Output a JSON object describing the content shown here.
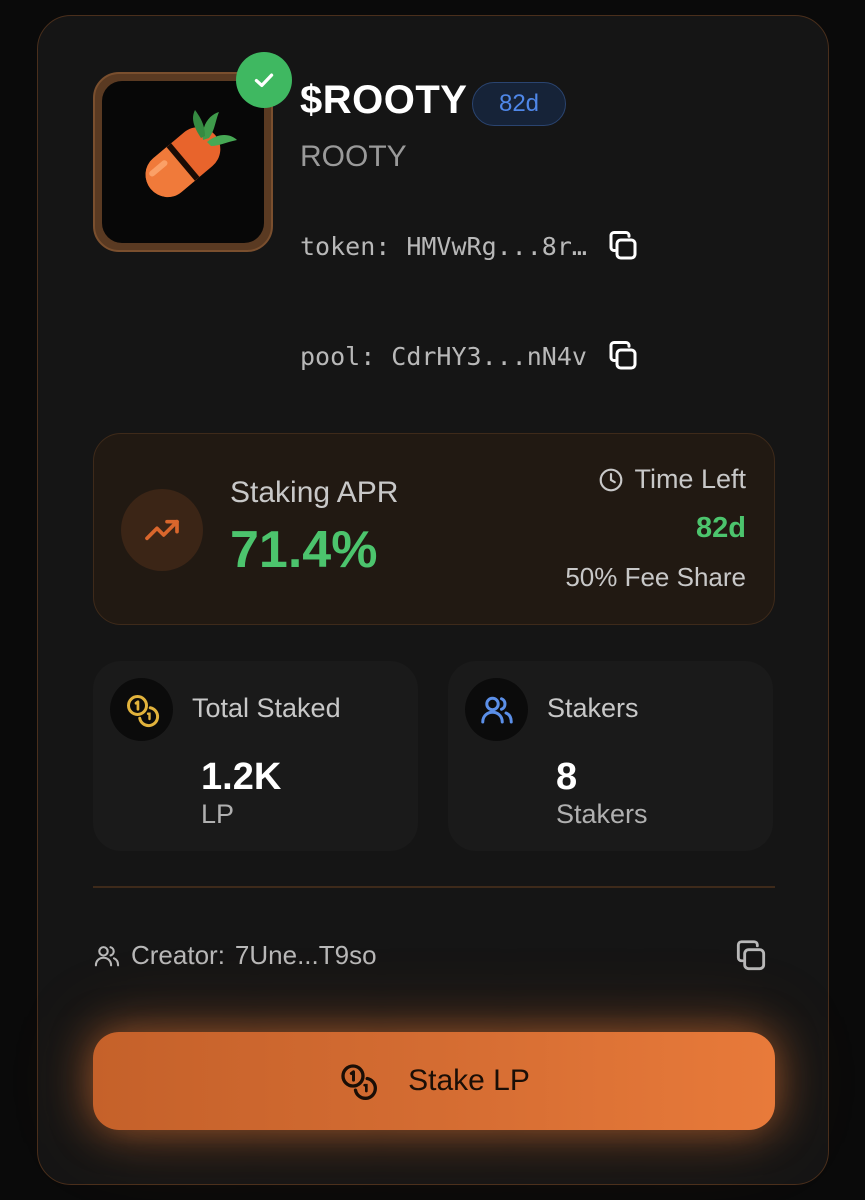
{
  "header": {
    "ticker": "$ROOTY",
    "days_badge": "82d",
    "name": "ROOTY",
    "token_label": "token:",
    "token_address": "HMVwRg...8r…",
    "pool_label": "pool:",
    "pool_address": "CdrHY3...nN4v",
    "logo_icon": "carrot-pill-icon",
    "verified_icon": "check-icon"
  },
  "apr": {
    "label": "Staking APR",
    "value": "71.4%",
    "time_left_label": "Time Left",
    "time_left_value": "82d",
    "fee_share": "50% Fee Share"
  },
  "stats": {
    "total_staked": {
      "label": "Total Staked",
      "value": "1.2K",
      "unit": "LP"
    },
    "stakers": {
      "label": "Stakers",
      "value": "8",
      "unit": "Stakers"
    }
  },
  "creator": {
    "label": "Creator:",
    "address": "7Une...T9so"
  },
  "stake_button": {
    "label": "Stake LP"
  },
  "colors": {
    "accent": "#e0722f",
    "positive": "#4cc46d",
    "badge_blue": "#4f87e8",
    "verified": "#3fb861"
  }
}
